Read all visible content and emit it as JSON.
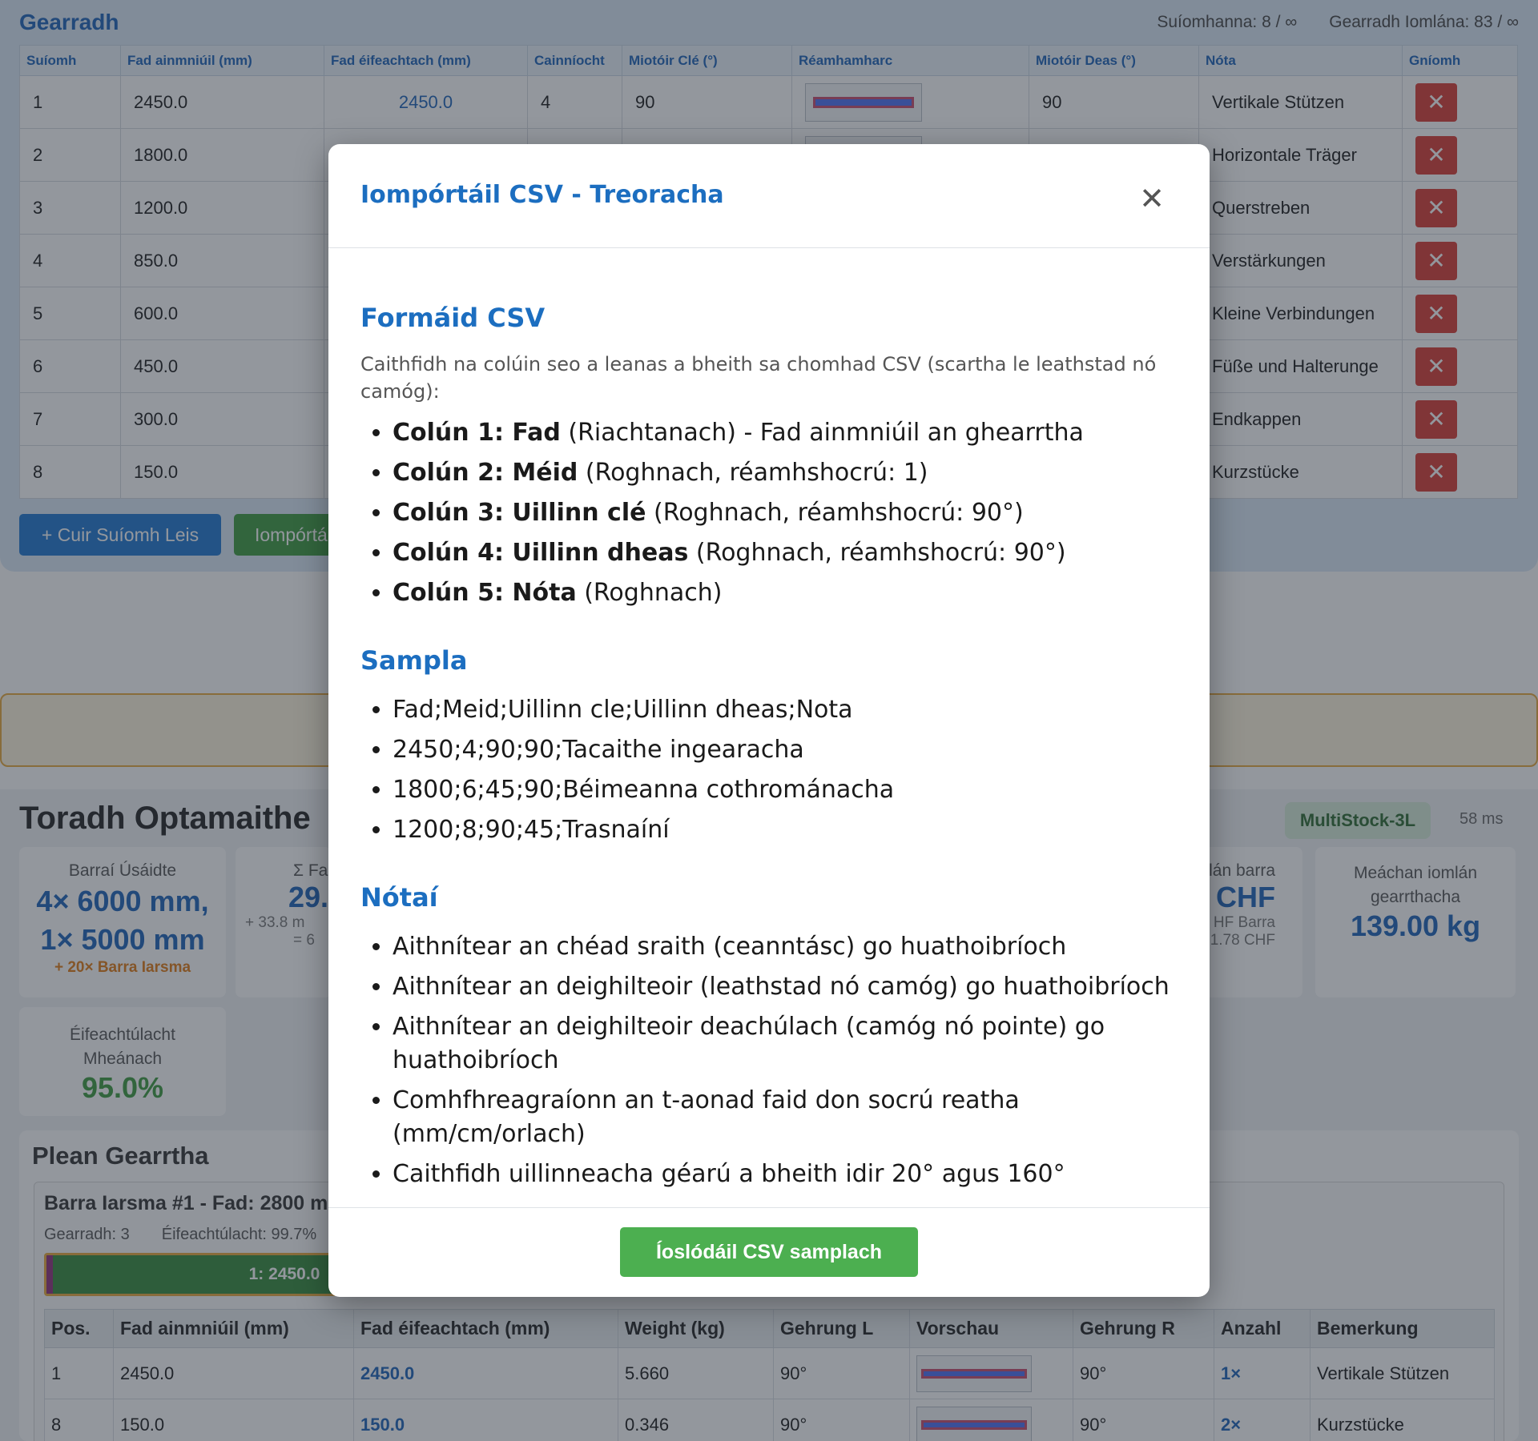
{
  "cuts": {
    "title": "Gearradh",
    "positions_counter": "Suíomhanna: 8 / ∞",
    "total_counter": "Gearradh Iomlána: 83 / ∞",
    "columns": [
      "Suíomh",
      "Fad ainmniúil (mm)",
      "Fad éifeachtach (mm)",
      "Cainníocht",
      "Miotóir Clé (°)",
      "Réamhamharc",
      "Miotóir Deas (°)",
      "Nóta",
      "Gníomh"
    ],
    "rows": [
      {
        "pos": "1",
        "nominal": "2450.0",
        "effective": "2450.0",
        "qty": "4",
        "left": "90",
        "right": "90",
        "note": "Vertikale Stützen"
      },
      {
        "pos": "2",
        "nominal": "1800.0",
        "effective": "",
        "qty": "",
        "left": "",
        "right": "",
        "note": "Horizontale Träger"
      },
      {
        "pos": "3",
        "nominal": "1200.0",
        "effective": "",
        "qty": "",
        "left": "",
        "right": "",
        "note": "Querstreben"
      },
      {
        "pos": "4",
        "nominal": "850.0",
        "effective": "",
        "qty": "",
        "left": "",
        "right": "",
        "note": "Verstärkungen"
      },
      {
        "pos": "5",
        "nominal": "600.0",
        "effective": "",
        "qty": "",
        "left": "",
        "right": "",
        "note": "Kleine Verbindungen"
      },
      {
        "pos": "6",
        "nominal": "450.0",
        "effective": "",
        "qty": "",
        "left": "",
        "right": "",
        "note": "Füße und Halterunge"
      },
      {
        "pos": "7",
        "nominal": "300.0",
        "effective": "",
        "qty": "",
        "left": "",
        "right": "",
        "note": "Endkappen"
      },
      {
        "pos": "8",
        "nominal": "150.0",
        "effective": "",
        "qty": "",
        "left": "",
        "right": "",
        "note": "Kurzstücke"
      }
    ],
    "add_label": "+ Cuir Suíomh Leis",
    "import_label": "Iompórtá"
  },
  "result": {
    "title": "Toradh Optamaithe",
    "algorithm": "MultiStock-3L",
    "time": "58 ms",
    "card_bars": {
      "label": "Barraí Úsáidte",
      "value": "4× 6000 mm, 1× 5000 mm",
      "extra": "+ 20× Barra Iarsma"
    },
    "card_sum": {
      "label": "Σ Fa",
      "value": "29.",
      "extra1": "+ 33.8 m",
      "extra2": "= 6"
    },
    "card_price": {
      "label": "lán barra",
      "value": "CHF",
      "extra1": "HF Barra",
      "extra2": "1.78 CHF"
    },
    "card_weight": {
      "label": "Meáchan iomlán gearrthacha",
      "value": "139.00 kg"
    },
    "card_efficiency": {
      "label": "Éifeachtúlacht Mheánach",
      "value": "95.0%"
    }
  },
  "plan": {
    "title": "Plean Gearrtha",
    "bar_heading": "Barra Iarsma #1 - Fad: 2800 m",
    "bar_cuts": "Gearradh: 3",
    "bar_efficiency": "Éifeachtúlacht: 99.7%",
    "segment_label": "1: 2450.0",
    "columns": [
      "Pos.",
      "Fad ainmniúil (mm)",
      "Fad éifeachtach (mm)",
      "Weight (kg)",
      "Gehrung L",
      "Vorschau",
      "Gehrung R",
      "Anzahl",
      "Bemerkung"
    ],
    "rows": [
      {
        "pos": "1",
        "nominal": "2450.0",
        "effective": "2450.0",
        "weight": "5.660",
        "left": "90°",
        "right": "90°",
        "qty": "1×",
        "note": "Vertikale Stützen"
      },
      {
        "pos": "8",
        "nominal": "150.0",
        "effective": "150.0",
        "weight": "0.346",
        "left": "90°",
        "right": "90°",
        "qty": "2×",
        "note": "Kurzstücke"
      }
    ]
  },
  "modal": {
    "title": "Iompórtáil CSV - Treoracha",
    "format_heading": "Formáid CSV",
    "format_intro": "Caithfidh na colúin seo a leanas a bheith sa chomhad CSV (scartha le leathstad nó camóg):",
    "columns": [
      {
        "name": "Colún 1: Fad",
        "desc": " (Riachtanach) - Fad ainmniúil an ghearrtha"
      },
      {
        "name": "Colún 2: Méid",
        "desc": " (Roghnach, réamhshocrú: 1)"
      },
      {
        "name": "Colún 3: Uillinn clé",
        "desc": " (Roghnach, réamhshocrú: 90°)"
      },
      {
        "name": "Colún 4: Uillinn dheas",
        "desc": " (Roghnach, réamhshocrú: 90°)"
      },
      {
        "name": "Colún 5: Nóta",
        "desc": " (Roghnach)"
      }
    ],
    "sample_heading": "Sampla",
    "sample_lines": [
      "Fad;Meid;Uillinn cle;Uillinn dheas;Nota",
      "2450;4;90;90;Tacaithe ingearacha",
      "1800;6;45;90;Béimeanna cothrománacha",
      "1200;8;90;45;Trasnaíní"
    ],
    "notes_heading": "Nótaí",
    "notes": [
      "Aithnítear an chéad sraith (ceanntásc) go huathoibríoch",
      "Aithnítear an deighilteoir (leathstad nó camóg) go huathoibríoch",
      "Aithnítear an deighilteoir deachúlach (camóg nó pointe) go huathoibríoch",
      "Comhfhreagraíonn an t-aonad faid don socrú reatha (mm/cm/orlach)",
      "Caithfidh uillinneacha géarú a bheith idir 20° agus 160°"
    ],
    "download_label": "Íoslódáil CSV samplach",
    "close_icon": "close-icon"
  }
}
